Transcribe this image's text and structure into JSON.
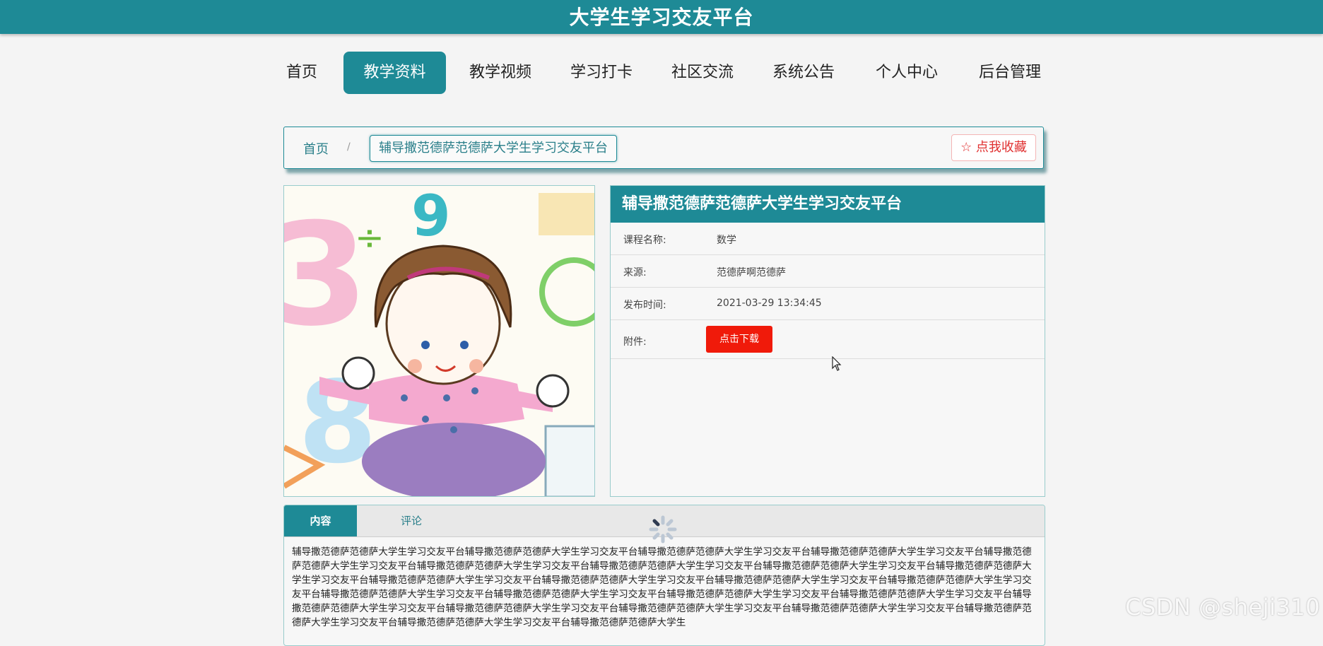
{
  "app": {
    "title": "大学生学习交友平台"
  },
  "nav": {
    "items": [
      "首页",
      "教学资料",
      "教学视频",
      "学习打卡",
      "社区交流",
      "系统公告",
      "个人中心",
      "后台管理"
    ],
    "active": "教学资料"
  },
  "breadcrumb": {
    "home": "首页",
    "separator": "/",
    "current": "辅导撒范德萨范德萨大学生学习交友平台",
    "favorite_label": "☆ 点我收藏"
  },
  "detail": {
    "title": "辅导撒范德萨范德萨大学生学习交友平台",
    "rows": [
      {
        "label": "课程名称:",
        "value": "数学"
      },
      {
        "label": "来源:",
        "value": "范德萨啊范德萨"
      },
      {
        "label": "发布时间:",
        "value": "2021-03-29 13:34:45"
      }
    ],
    "attachment_label": "附件:",
    "download_label": "点击下载"
  },
  "tabs": {
    "content_label": "内容",
    "comment_label": "评论",
    "content_text": "辅导撒范德萨范德萨大学生学习交友平台辅导撒范德萨范德萨大学生学习交友平台辅导撒范德萨范德萨大学生学习交友平台辅导撒范德萨范德萨大学生学习交友平台辅导撒范德萨范德萨大学生学习交友平台辅导撒范德萨范德萨大学生学习交友平台辅导撒范德萨范德萨大学生学习交友平台辅导撒范德萨范德萨大学生学习交友平台辅导撒范德萨范德萨大学生学习交友平台辅导撒范德萨范德萨大学生学习交友平台辅导撒范德萨范德萨大学生学习交友平台辅导撒范德萨范德萨大学生学习交友平台辅导撒范德萨范德萨大学生学习交友平台辅导撒范德萨范德萨大学生学习交友平台辅导撒范德萨范德萨大学生学习交友平台辅导撒范德萨范德萨大学生学习交友平台辅导撒范德萨范德萨大学生学习交友平台辅导撒范德萨范德萨大学生学习交友平台辅导撒范德萨范德萨大学生学习交友平台辅导撒范德萨范德萨大学生学习交友平台辅导撒范德萨范德萨大学生学习交友平台辅导撒范德萨范德萨大学生学习交友平台辅导撒范德萨范德萨大学生学习交友平台辅导撒范德萨范德萨大学生"
  },
  "watermark": "CSDN @sheji310",
  "colors": {
    "primary": "#1e8a96",
    "download": "#f01a0a",
    "favorite": "#e03030"
  }
}
